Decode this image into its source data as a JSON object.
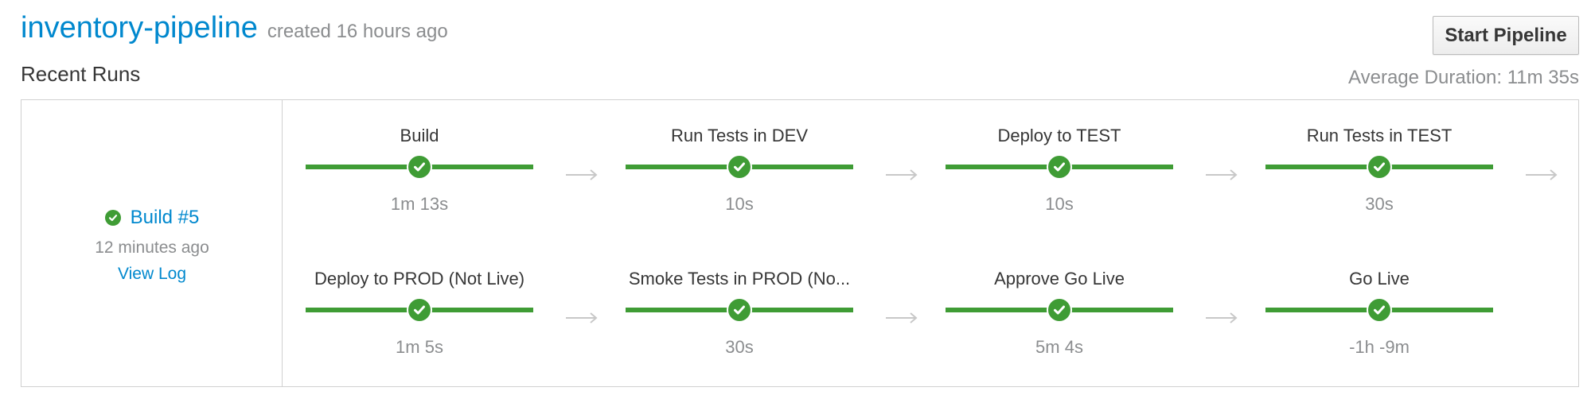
{
  "header": {
    "pipeline_name": "inventory-pipeline",
    "created": "created 16 hours ago",
    "start_button": "Start Pipeline",
    "recent_runs": "Recent Runs",
    "average_duration": "Average Duration: 11m 35s"
  },
  "build": {
    "title": "Build #5",
    "time": "12 minutes ago",
    "view_log": "View Log",
    "status": "success"
  },
  "stages": [
    {
      "name": "Build",
      "duration": "1m 13s",
      "status": "success"
    },
    {
      "name": "Run Tests in DEV",
      "duration": "10s",
      "status": "success"
    },
    {
      "name": "Deploy to TEST",
      "duration": "10s",
      "status": "success"
    },
    {
      "name": "Run Tests in TEST",
      "duration": "30s",
      "status": "success"
    },
    {
      "name": "Deploy to PROD (Not Live)",
      "duration": "1m 5s",
      "status": "success"
    },
    {
      "name": "Smoke Tests in PROD (No...",
      "duration": "30s",
      "status": "success"
    },
    {
      "name": "Approve Go Live",
      "duration": "5m 4s",
      "status": "success"
    },
    {
      "name": "Go Live",
      "duration": "-1h -9m",
      "status": "success"
    }
  ],
  "colors": {
    "success": "#3f9c35",
    "link": "#0088ce",
    "muted": "#8b8d8f",
    "arrow": "#c8c8c8"
  },
  "icons": {
    "stage_status": "check-circle-icon",
    "build_status": "check-circle-icon",
    "connector": "arrow-right-icon"
  }
}
